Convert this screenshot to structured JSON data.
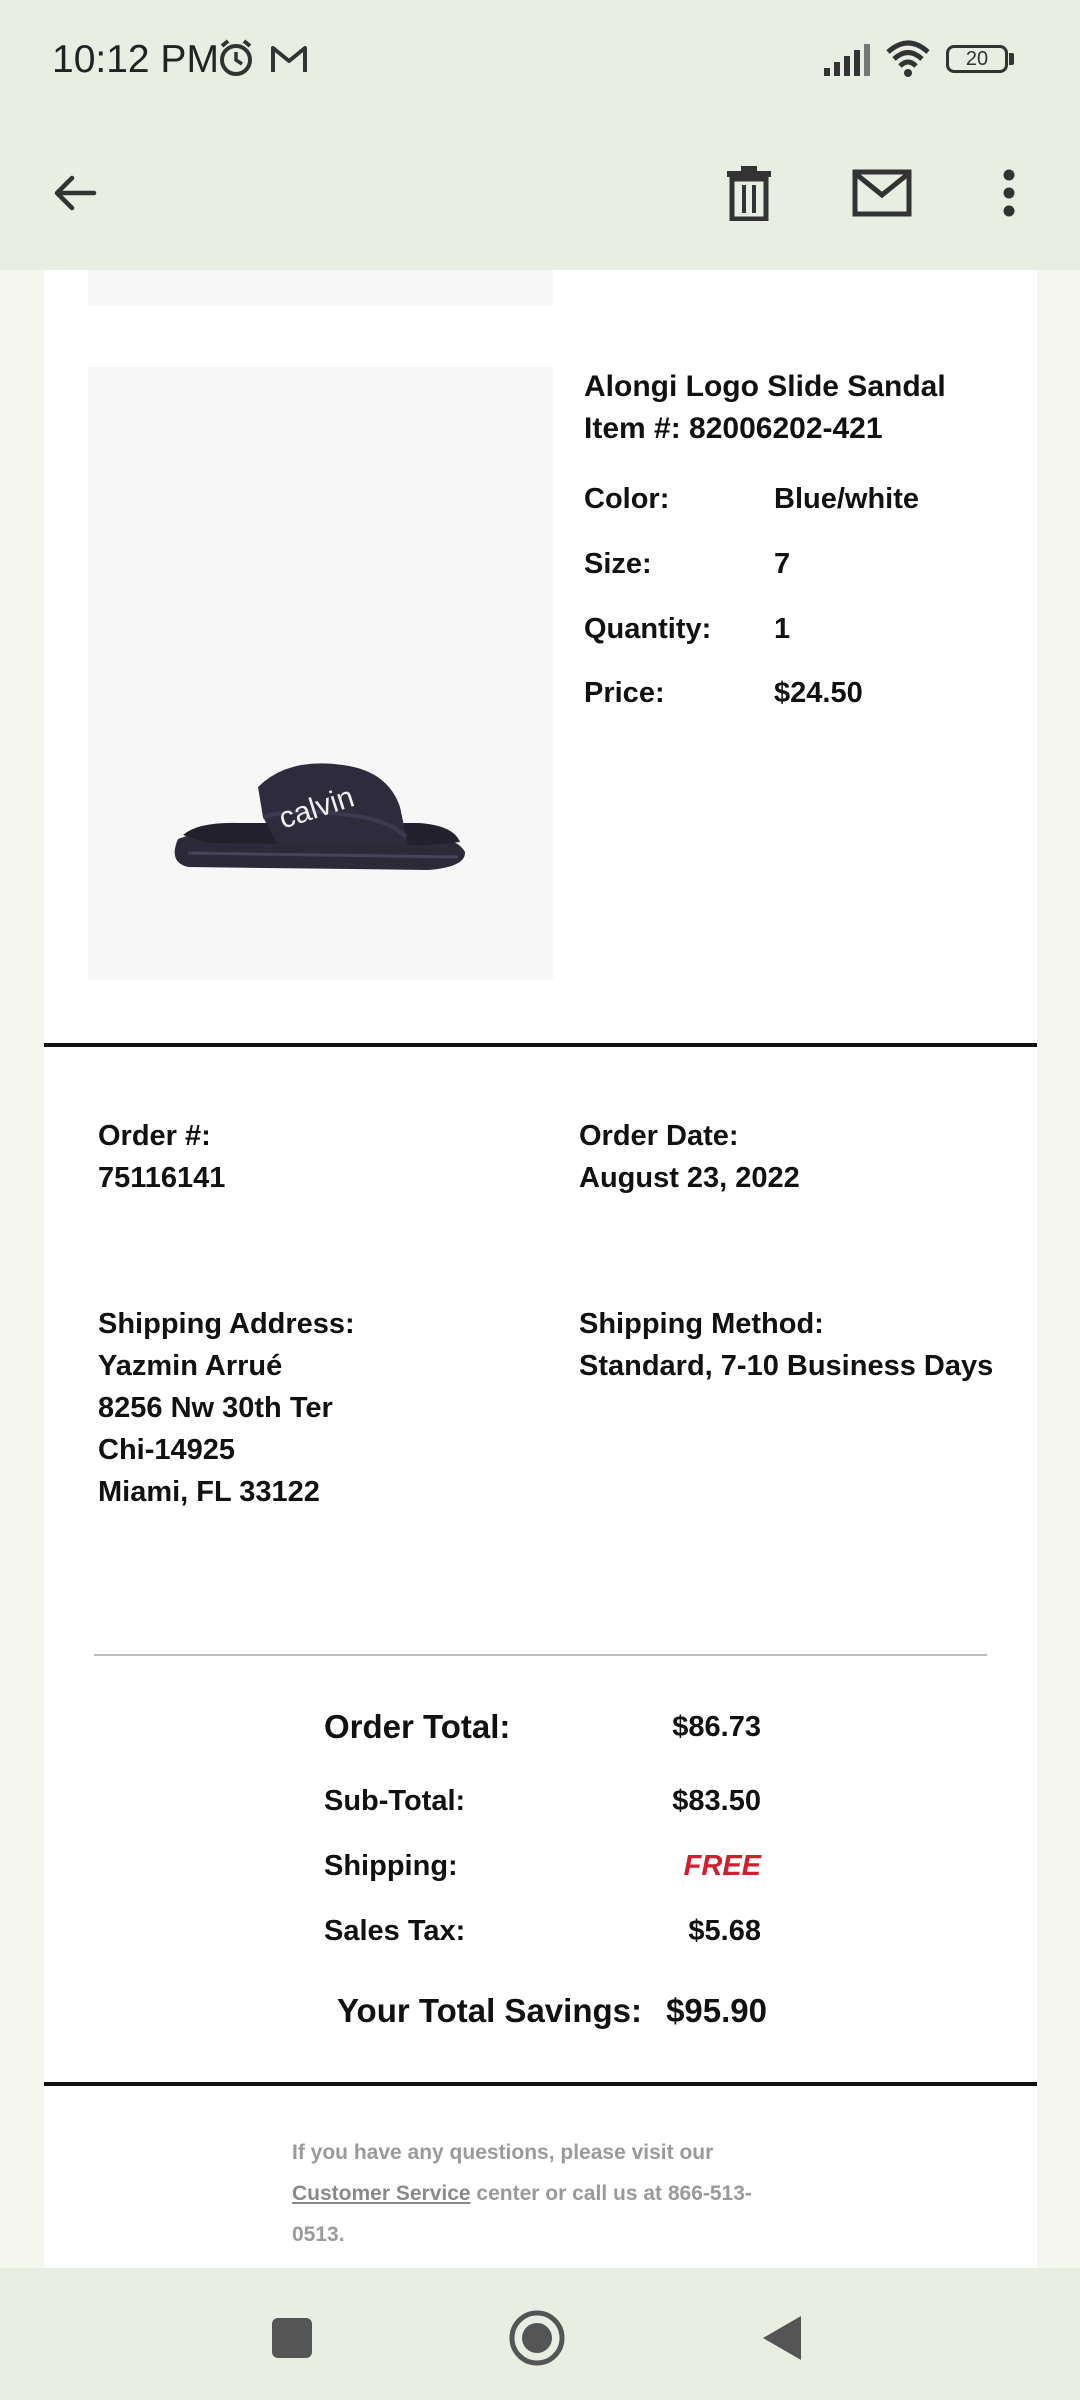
{
  "status_bar": {
    "time": "10:12 PM",
    "battery": "20",
    "icons": [
      "alarm-icon",
      "gmail-icon",
      "signal-icon",
      "wifi-icon",
      "battery-icon"
    ]
  },
  "app_bar": {
    "icons": [
      "back-arrow-icon",
      "delete-icon",
      "mark-unread-icon",
      "more-vert-icon"
    ]
  },
  "product": {
    "name": "Alongi Logo Slide Sandal",
    "item_no": "Item #: 82006202-421",
    "image_alt": "Calvin Klein slide sandal",
    "details": [
      {
        "label": "Color:",
        "value": "Blue/white"
      },
      {
        "label": "Size:",
        "value": "7"
      },
      {
        "label": "Quantity:",
        "value": "1"
      },
      {
        "label": "Price:",
        "value": "$24.50"
      }
    ]
  },
  "order": {
    "order_no_label": "Order #:",
    "order_no": "75116141",
    "order_date_label": "Order Date:",
    "order_date": "August 23, 2022",
    "shipping_address_label": "Shipping Address:",
    "shipping_address": [
      "Yazmin Arrué",
      "8256 Nw 30th Ter",
      "Chi-14925",
      "Miami, FL 33122"
    ],
    "shipping_method_label": "Shipping Method:",
    "shipping_method": "Standard, 7-10 Business Days"
  },
  "totals": {
    "order_total_label": "Order Total:",
    "order_total": "$86.73",
    "subtotal_label": "Sub-Total:",
    "subtotal": "$83.50",
    "shipping_label": "Shipping:",
    "shipping": "FREE",
    "tax_label": "Sales Tax:",
    "tax": "$5.68",
    "savings_label": "Your Total Savings:",
    "savings": "$95.90"
  },
  "footer": {
    "line1": "If you have any questions, please visit our",
    "link": "Customer Service",
    "line2": " center or call us at 866-513-",
    "line3": "0513."
  },
  "colors": {
    "free_red": "#d0202e",
    "chrome_bg": "#e9eee2"
  },
  "nav_bar": {
    "icons": [
      "recents-square-icon",
      "home-circle-icon",
      "back-triangle-icon"
    ]
  }
}
